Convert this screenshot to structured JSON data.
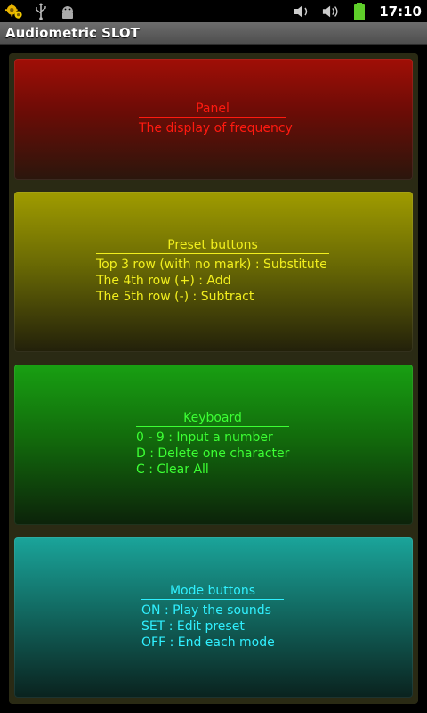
{
  "status_bar": {
    "left_icons": [
      "settings-gears-icon",
      "usb-icon",
      "android-debug-icon"
    ],
    "right_icons": [
      "volume-icon",
      "ringer-volume-icon",
      "battery-icon"
    ],
    "time": "17:10"
  },
  "app": {
    "title": "Audiometric SLOT"
  },
  "colors": {
    "panel_red": "#ff1a10",
    "panel_yellow": "#f2ef1e",
    "panel_green": "#3cff34",
    "panel_teal": "#30f0ff"
  },
  "panels": [
    {
      "title": "Panel",
      "lines": [
        "The display of frequency"
      ]
    },
    {
      "title": "Preset buttons",
      "lines": [
        "Top 3 row (with no mark) : Substitute",
        "The 4th row (+) : Add",
        "The 5th row (-) : Subtract"
      ]
    },
    {
      "title": "Keyboard",
      "lines": [
        "0 - 9 : Input a number",
        "D : Delete one character",
        "C : Clear All"
      ]
    },
    {
      "title": "Mode buttons",
      "lines": [
        "ON : Play the sounds",
        "SET : Edit preset",
        "OFF : End each mode"
      ]
    }
  ]
}
